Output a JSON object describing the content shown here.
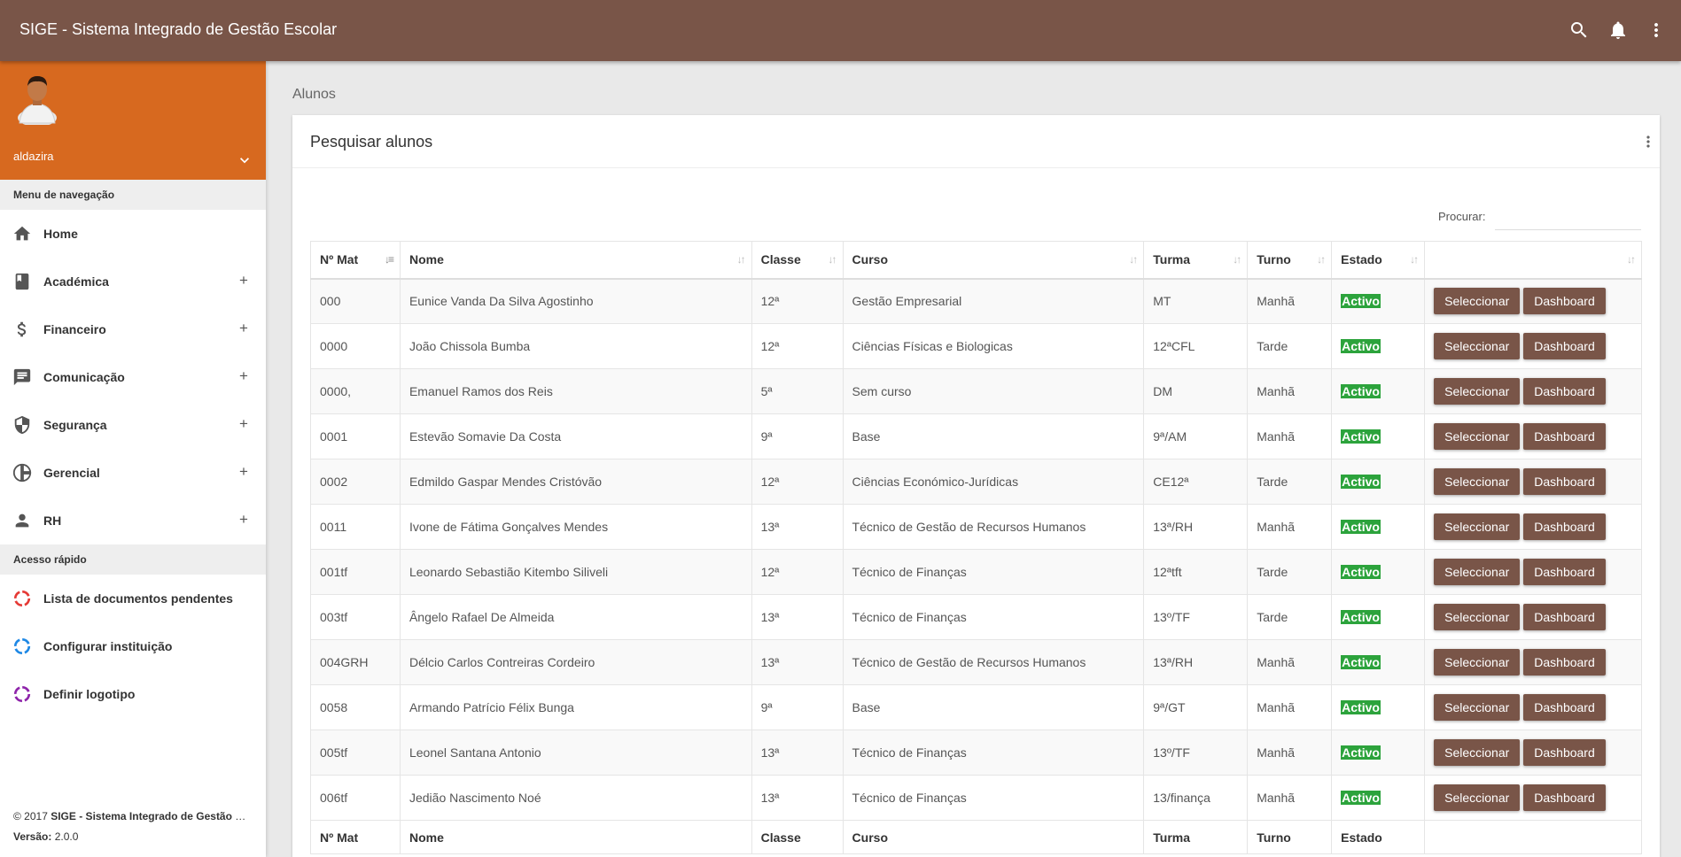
{
  "app": {
    "title": "SIGE - Sistema Integrado de Gestão Escolar"
  },
  "topbar_icons": [
    "search-icon",
    "bell-icon",
    "more-vert-icon"
  ],
  "user": {
    "name": "aldazira"
  },
  "sidebar": {
    "nav_header": "Menu de navegação",
    "items": [
      {
        "label": "Home",
        "icon": "home-icon",
        "expandable": false
      },
      {
        "label": "Académica",
        "icon": "book-icon",
        "expandable": true
      },
      {
        "label": "Financeiro",
        "icon": "dollar-icon",
        "expandable": true
      },
      {
        "label": "Comunicação",
        "icon": "message-icon",
        "expandable": true
      },
      {
        "label": "Segurança",
        "icon": "shield-icon",
        "expandable": true
      },
      {
        "label": "Gerencial",
        "icon": "pie-chart-icon",
        "expandable": true
      },
      {
        "label": "RH",
        "icon": "person-icon",
        "expandable": true
      }
    ],
    "quick_header": "Acesso rápido",
    "quick_items": [
      {
        "label": "Lista de documentos pendentes",
        "icon": "circle-red-icon",
        "color": "#e53935"
      },
      {
        "label": "Configurar instituição",
        "icon": "circle-blue-icon",
        "color": "#1e88e5"
      },
      {
        "label": "Definir logotipo",
        "icon": "circle-purple-icon",
        "color": "#8e24aa"
      }
    ],
    "plus": "+",
    "footer": {
      "copyright_prefix": "© 2017 ",
      "copyright_name": "SIGE - Sistema Integrado de Gestão Escolar",
      "version_label": "Versão:",
      "version": " 2.0.0"
    }
  },
  "breadcrumb": "Alunos",
  "card": {
    "title": "Pesquisar alunos",
    "search_label": "Procurar:",
    "search_value": ""
  },
  "table": {
    "columns": [
      "Nº Mat",
      "Nome",
      "Classe",
      "Curso",
      "Turma",
      "Turno",
      "Estado"
    ],
    "select_label": "Seleccionar",
    "dashboard_label": "Dashboard",
    "rows": [
      {
        "mat": "000",
        "nome": "Eunice Vanda Da Silva Agostinho",
        "classe": "12ª",
        "curso": "Gestão Empresarial",
        "turma": "MT",
        "turno": "Manhã",
        "estado": "Activo"
      },
      {
        "mat": "0000",
        "nome": "João Chissola Bumba",
        "classe": "12ª",
        "curso": "Ciências Físicas e Biologicas",
        "turma": "12ªCFL",
        "turno": "Tarde",
        "estado": "Activo"
      },
      {
        "mat": "0000,",
        "nome": "Emanuel Ramos dos Reis",
        "classe": "5ª",
        "curso": "Sem curso",
        "turma": "DM",
        "turno": "Manhã",
        "estado": "Activo"
      },
      {
        "mat": "0001",
        "nome": "Estevão Somavie Da Costa",
        "classe": "9ª",
        "curso": "Base",
        "turma": "9ª/AM",
        "turno": "Manhã",
        "estado": "Activo"
      },
      {
        "mat": "0002",
        "nome": "Edmildo Gaspar Mendes Cristóvão",
        "classe": "12ª",
        "curso": "Ciências Económico-Jurídicas",
        "turma": "CE12ª",
        "turno": "Tarde",
        "estado": "Activo"
      },
      {
        "mat": "0011",
        "nome": "Ivone de Fátima Gonçalves Mendes",
        "classe": "13ª",
        "curso": "Técnico de Gestão de Recursos Humanos",
        "turma": "13ª/RH",
        "turno": "Manhã",
        "estado": "Activo"
      },
      {
        "mat": "001tf",
        "nome": "Leonardo Sebastião Kitembo Siliveli",
        "classe": "12ª",
        "curso": "Técnico de Finanças",
        "turma": "12ªtft",
        "turno": "Tarde",
        "estado": "Activo"
      },
      {
        "mat": "003tf",
        "nome": "Ângelo Rafael De Almeida",
        "classe": "13ª",
        "curso": "Técnico de Finanças",
        "turma": "13º/TF",
        "turno": "Tarde",
        "estado": "Activo"
      },
      {
        "mat": "004GRH",
        "nome": "Délcio Carlos Contreiras Cordeiro",
        "classe": "13ª",
        "curso": "Técnico de Gestão de Recursos Humanos",
        "turma": "13ª/RH",
        "turno": "Manhã",
        "estado": "Activo"
      },
      {
        "mat": "0058",
        "nome": "Armando Patrício Félix Bunga",
        "classe": "9ª",
        "curso": "Base",
        "turma": "9ª/GT",
        "turno": "Manhã",
        "estado": "Activo"
      },
      {
        "mat": "005tf",
        "nome": "Leonel Santana Antonio",
        "classe": "13ª",
        "curso": "Técnico de Finanças",
        "turma": "13º/TF",
        "turno": "Manhã",
        "estado": "Activo"
      },
      {
        "mat": "006tf",
        "nome": "Jedião Nascimento Noé",
        "classe": "13ª",
        "curso": "Técnico de Finanças",
        "turma": "13/finança",
        "turno": "Manhã",
        "estado": "Activo"
      }
    ]
  }
}
